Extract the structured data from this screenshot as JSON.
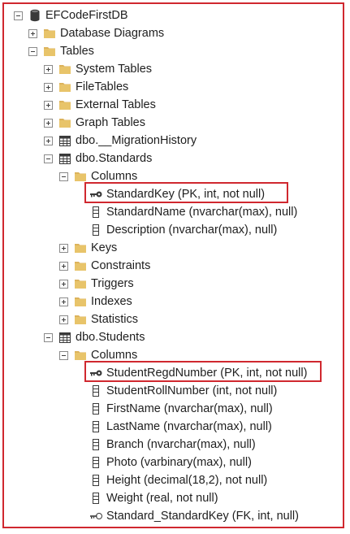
{
  "tree": {
    "root": "EFCodeFirstDB",
    "database_diagrams": "Database Diagrams",
    "tables": "Tables",
    "system_tables": "System Tables",
    "file_tables": "FileTables",
    "external_tables": "External Tables",
    "graph_tables": "Graph Tables",
    "migration_history": "dbo.__MigrationHistory",
    "standards": {
      "name": "dbo.Standards",
      "columns_label": "Columns",
      "columns": [
        "StandardKey (PK, int, not null)",
        "StandardName (nvarchar(max), null)",
        "Description (nvarchar(max), null)"
      ],
      "keys": "Keys",
      "constraints": "Constraints",
      "triggers": "Triggers",
      "indexes": "Indexes",
      "statistics": "Statistics"
    },
    "students": {
      "name": "dbo.Students",
      "columns_label": "Columns",
      "columns": [
        "StudentRegdNumber (PK, int, not null)",
        "StudentRollNumber (int, not null)",
        "FirstName (nvarchar(max), null)",
        "LastName (nvarchar(max), null)",
        "Branch (nvarchar(max), null)",
        "Photo (varbinary(max), null)",
        "Height (decimal(18,2), not null)",
        "Weight (real, not null)",
        "Standard_StandardKey (FK, int, null)"
      ]
    }
  },
  "colors": {
    "highlight": "#d0282f",
    "folder": "#dcb35c"
  },
  "icons": [
    "database-icon",
    "folder-icon",
    "table-icon",
    "primary-key-icon",
    "column-icon",
    "foreign-key-icon"
  ]
}
